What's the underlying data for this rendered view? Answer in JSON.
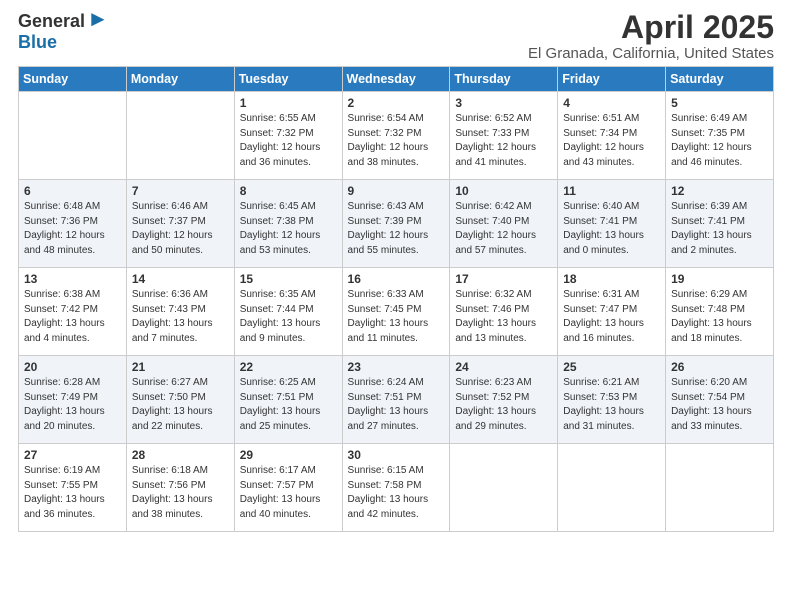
{
  "header": {
    "logo_general": "General",
    "logo_blue": "Blue",
    "title": "April 2025",
    "subtitle": "El Granada, California, United States"
  },
  "days_of_week": [
    "Sunday",
    "Monday",
    "Tuesday",
    "Wednesday",
    "Thursday",
    "Friday",
    "Saturday"
  ],
  "weeks": [
    [
      {
        "day": "",
        "info": ""
      },
      {
        "day": "",
        "info": ""
      },
      {
        "day": "1",
        "info": "Sunrise: 6:55 AM\nSunset: 7:32 PM\nDaylight: 12 hours and 36 minutes."
      },
      {
        "day": "2",
        "info": "Sunrise: 6:54 AM\nSunset: 7:32 PM\nDaylight: 12 hours and 38 minutes."
      },
      {
        "day": "3",
        "info": "Sunrise: 6:52 AM\nSunset: 7:33 PM\nDaylight: 12 hours and 41 minutes."
      },
      {
        "day": "4",
        "info": "Sunrise: 6:51 AM\nSunset: 7:34 PM\nDaylight: 12 hours and 43 minutes."
      },
      {
        "day": "5",
        "info": "Sunrise: 6:49 AM\nSunset: 7:35 PM\nDaylight: 12 hours and 46 minutes."
      }
    ],
    [
      {
        "day": "6",
        "info": "Sunrise: 6:48 AM\nSunset: 7:36 PM\nDaylight: 12 hours and 48 minutes."
      },
      {
        "day": "7",
        "info": "Sunrise: 6:46 AM\nSunset: 7:37 PM\nDaylight: 12 hours and 50 minutes."
      },
      {
        "day": "8",
        "info": "Sunrise: 6:45 AM\nSunset: 7:38 PM\nDaylight: 12 hours and 53 minutes."
      },
      {
        "day": "9",
        "info": "Sunrise: 6:43 AM\nSunset: 7:39 PM\nDaylight: 12 hours and 55 minutes."
      },
      {
        "day": "10",
        "info": "Sunrise: 6:42 AM\nSunset: 7:40 PM\nDaylight: 12 hours and 57 minutes."
      },
      {
        "day": "11",
        "info": "Sunrise: 6:40 AM\nSunset: 7:41 PM\nDaylight: 13 hours and 0 minutes."
      },
      {
        "day": "12",
        "info": "Sunrise: 6:39 AM\nSunset: 7:41 PM\nDaylight: 13 hours and 2 minutes."
      }
    ],
    [
      {
        "day": "13",
        "info": "Sunrise: 6:38 AM\nSunset: 7:42 PM\nDaylight: 13 hours and 4 minutes."
      },
      {
        "day": "14",
        "info": "Sunrise: 6:36 AM\nSunset: 7:43 PM\nDaylight: 13 hours and 7 minutes."
      },
      {
        "day": "15",
        "info": "Sunrise: 6:35 AM\nSunset: 7:44 PM\nDaylight: 13 hours and 9 minutes."
      },
      {
        "day": "16",
        "info": "Sunrise: 6:33 AM\nSunset: 7:45 PM\nDaylight: 13 hours and 11 minutes."
      },
      {
        "day": "17",
        "info": "Sunrise: 6:32 AM\nSunset: 7:46 PM\nDaylight: 13 hours and 13 minutes."
      },
      {
        "day": "18",
        "info": "Sunrise: 6:31 AM\nSunset: 7:47 PM\nDaylight: 13 hours and 16 minutes."
      },
      {
        "day": "19",
        "info": "Sunrise: 6:29 AM\nSunset: 7:48 PM\nDaylight: 13 hours and 18 minutes."
      }
    ],
    [
      {
        "day": "20",
        "info": "Sunrise: 6:28 AM\nSunset: 7:49 PM\nDaylight: 13 hours and 20 minutes."
      },
      {
        "day": "21",
        "info": "Sunrise: 6:27 AM\nSunset: 7:50 PM\nDaylight: 13 hours and 22 minutes."
      },
      {
        "day": "22",
        "info": "Sunrise: 6:25 AM\nSunset: 7:51 PM\nDaylight: 13 hours and 25 minutes."
      },
      {
        "day": "23",
        "info": "Sunrise: 6:24 AM\nSunset: 7:51 PM\nDaylight: 13 hours and 27 minutes."
      },
      {
        "day": "24",
        "info": "Sunrise: 6:23 AM\nSunset: 7:52 PM\nDaylight: 13 hours and 29 minutes."
      },
      {
        "day": "25",
        "info": "Sunrise: 6:21 AM\nSunset: 7:53 PM\nDaylight: 13 hours and 31 minutes."
      },
      {
        "day": "26",
        "info": "Sunrise: 6:20 AM\nSunset: 7:54 PM\nDaylight: 13 hours and 33 minutes."
      }
    ],
    [
      {
        "day": "27",
        "info": "Sunrise: 6:19 AM\nSunset: 7:55 PM\nDaylight: 13 hours and 36 minutes."
      },
      {
        "day": "28",
        "info": "Sunrise: 6:18 AM\nSunset: 7:56 PM\nDaylight: 13 hours and 38 minutes."
      },
      {
        "day": "29",
        "info": "Sunrise: 6:17 AM\nSunset: 7:57 PM\nDaylight: 13 hours and 40 minutes."
      },
      {
        "day": "30",
        "info": "Sunrise: 6:15 AM\nSunset: 7:58 PM\nDaylight: 13 hours and 42 minutes."
      },
      {
        "day": "",
        "info": ""
      },
      {
        "day": "",
        "info": ""
      },
      {
        "day": "",
        "info": ""
      }
    ]
  ]
}
